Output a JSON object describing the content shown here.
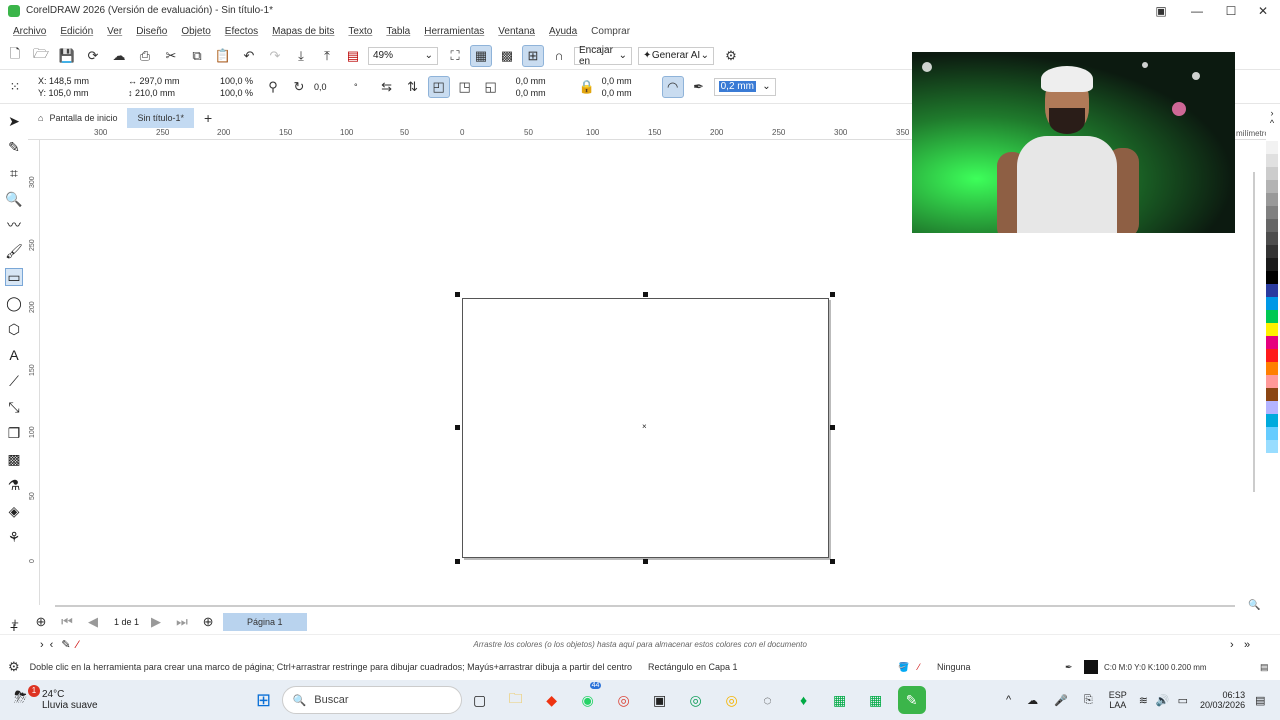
{
  "window": {
    "title": "CorelDRAW 2026 (Versión de evaluación) - Sin título-1*",
    "minimize": "—",
    "maximize": "☐",
    "close": "✕"
  },
  "menu": [
    "Archivo",
    "Edición",
    "Ver",
    "Diseño",
    "Objeto",
    "Efectos",
    "Mapas de bits",
    "Texto",
    "Tabla",
    "Herramientas",
    "Ventana",
    "Ayuda",
    "Comprar"
  ],
  "toolbar": {
    "zoom": "49%",
    "snap_label": "Encajar en",
    "ai_label": "Generar AI"
  },
  "propbar": {
    "x": "X:  148,5 mm",
    "y": "Y:  105,0 mm",
    "w": "297,0 mm",
    "h": "210,0 mm",
    "sx": "100,0",
    "sy": "100,0",
    "pct1": "%",
    "pct2": "%",
    "angle": "0,0",
    "deg": "°",
    "c1": "0,0 mm",
    "c2": "0,0 mm",
    "c3": "0,0 mm",
    "c4": "0,0 mm",
    "outline": "0,2 mm"
  },
  "tabs": {
    "home": "Pantalla de inicio",
    "doc": "Sin título-1*"
  },
  "ruler": {
    "h_ticks": [
      "300",
      "250",
      "200",
      "150",
      "100",
      "50",
      "0",
      "50",
      "100",
      "150",
      "200",
      "250",
      "300",
      "350"
    ],
    "v_ticks": [
      "300",
      "250",
      "200",
      "150",
      "100",
      "50",
      "0"
    ],
    "unit": "milímetros"
  },
  "palette_colors": [
    "#ffffff",
    "#f2f2f2",
    "#e0e0e0",
    "#cccccc",
    "#b3b3b3",
    "#999999",
    "#808080",
    "#666666",
    "#4d4d4d",
    "#333333",
    "#1a1a1a",
    "#000000",
    "#2a3b9f",
    "#0099e6",
    "#00c853",
    "#fff000",
    "#e6007e",
    "#ff1a1a",
    "#ff7f00",
    "#ff9999",
    "#8b4513",
    "#b3b3ff",
    "#00aadd",
    "#66ccff",
    "#99ddff"
  ],
  "pagebar": {
    "page_of": "1  de  1",
    "page_tab": "Página 1"
  },
  "colorbar": {
    "hint": "Arrastre los colores (o los objetos) hasta aquí para almacenar estos colores con el documento"
  },
  "status": {
    "hint": "Doble clic en la herramienta para crear una marco de página; Ctrl+arrastrar restringe para dibujar cuadrados; Mayús+arrastrar dibuja a partir del centro",
    "object": "Rectángulo en Capa 1",
    "fill": "Ninguna",
    "outline": "C:0 M:0 Y:0 K:100  0.200 mm"
  },
  "taskbar": {
    "temp": "24°C",
    "weather": "Lluvia suave",
    "search": "Buscar",
    "lang1": "ESP",
    "lang2": "LAA",
    "time": "06:13",
    "date": "20/03/2026",
    "badge": "1",
    "whatsapp_badge": "44"
  }
}
